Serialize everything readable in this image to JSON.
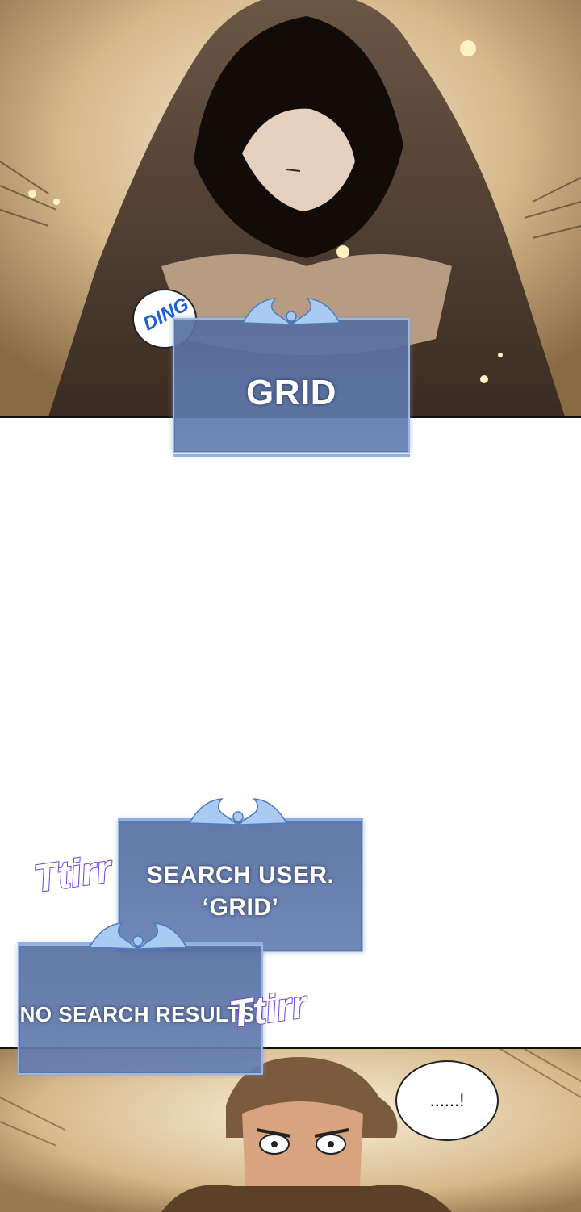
{
  "panel1": {
    "sfx_ding": "DING",
    "system_message": "GRID"
  },
  "panel2": {
    "system_message_1": [
      "SEARCH USER.",
      "‘GRID’"
    ],
    "system_message_2": "NO SEARCH RESULTS.",
    "sfx_1": "Ttirr",
    "sfx_2": "Ttirr"
  },
  "panel3": {
    "speech_bubble": "......!"
  },
  "colors": {
    "system_box": "#6a84b8",
    "system_border": "#9fb6dc",
    "sfx_stroke": "#6a44d9",
    "ding_text": "#1f5fd6"
  }
}
